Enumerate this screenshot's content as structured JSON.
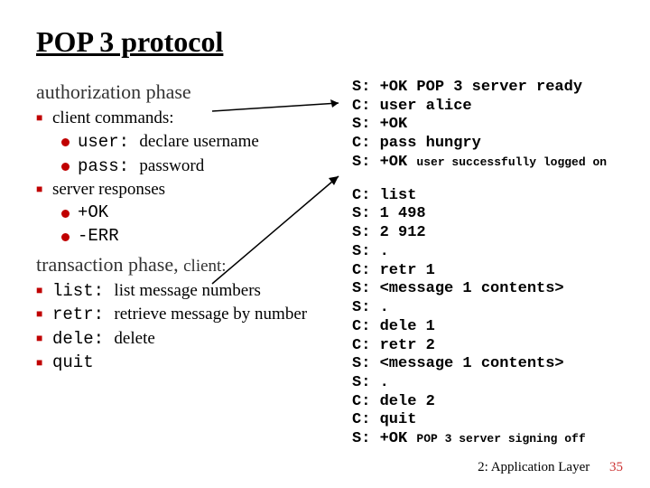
{
  "title": "POP 3 protocol",
  "left": {
    "sub1": "authorization phase",
    "b1": "client commands:",
    "b1a_pre": "user: ",
    "b1a_post": "declare username",
    "b1b_pre": "pass: ",
    "b1b_post": "password",
    "b2": "server responses",
    "b2a": "+OK",
    "b2b": "-ERR",
    "sub2": "transaction phase, ",
    "sub2_tail": "client:",
    "t1_pre": "list: ",
    "t1_post": "list message numbers",
    "t2_pre": "retr: ",
    "t2_post": "retrieve message by number",
    "t3_pre": "dele: ",
    "t3_post": "delete",
    "t4": "quit"
  },
  "term": {
    "a1": "S: +OK POP 3 server ready",
    "a2": "C: user alice",
    "a3": "S: +OK",
    "a4": "C: pass hungry",
    "a5a": "S: +OK ",
    "a5b": "user successfully logged on",
    "b1": "C: list",
    "b2": "S: 1 498",
    "b3": "S: 2 912",
    "b4": "S: .",
    "b5": "C: retr 1",
    "b6": "S: <message 1 contents>",
    "b7": "S: .",
    "b8": "C: dele 1",
    "b9": "C: retr 2",
    "b10": "S: <message 1 contents>",
    "b11": "S: .",
    "b12": "C: dele 2",
    "b13": "C: quit",
    "b14a": "S: +OK ",
    "b14b": "POP 3 server signing off"
  },
  "footer": {
    "chapter": "2: Application Layer",
    "page": "35"
  }
}
